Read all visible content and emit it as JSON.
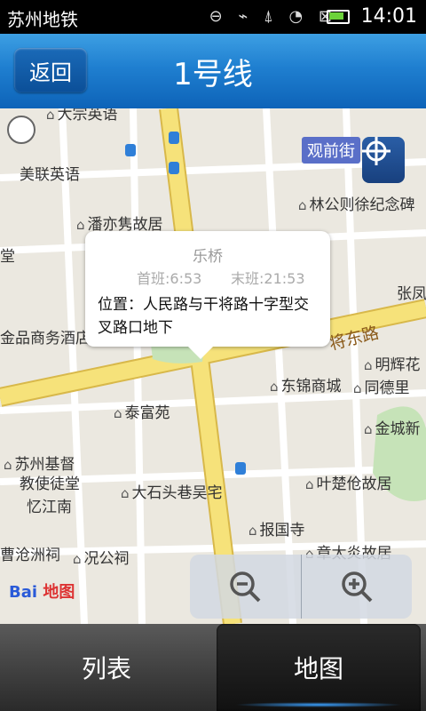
{
  "status": {
    "app_name": "苏州地铁",
    "time": "14:01"
  },
  "header": {
    "back_label": "返回",
    "title": "1号线"
  },
  "map": {
    "labels": {
      "dajing": "大宗英语",
      "meilian": "美联英语",
      "panyiju": "潘亦隽故居",
      "tang": "堂",
      "linggongxu": "林公则徐纪念碑",
      "zhangfeng": "张凤",
      "jinpin": "金品商务酒店",
      "jiangdong": "将东路",
      "minghui": "明辉花",
      "dongjin": "东锦商城",
      "tongde": "同德里",
      "taifu": "泰富苑",
      "jincheng": "金城新",
      "suzhou_jidu": "苏州基督",
      "jiaoshi": "教使徒堂",
      "yijiang": "忆江南",
      "dashitou": "大石头巷吴宅",
      "yechulun": "叶楚伧故居",
      "baoguo": "报国寺",
      "caocang": "曹沧洲祠",
      "kuanggong": "况公祠",
      "zhangtaiyan": "章太炎故居",
      "station_name": "观前街"
    },
    "callout": {
      "name": "乐桥",
      "first_train": "首班:6:53",
      "last_train": "末班:21:53",
      "position": "位置：人民路与干将路十字型交叉路口地下"
    },
    "logo": {
      "brand": "Bai",
      "suffix": "地图"
    }
  },
  "tabs": {
    "list": "列表",
    "map": "地图"
  },
  "colors": {
    "title_bar": "#1f7fd0",
    "road": "#f4e06c",
    "accent": "#3aa0ff"
  }
}
